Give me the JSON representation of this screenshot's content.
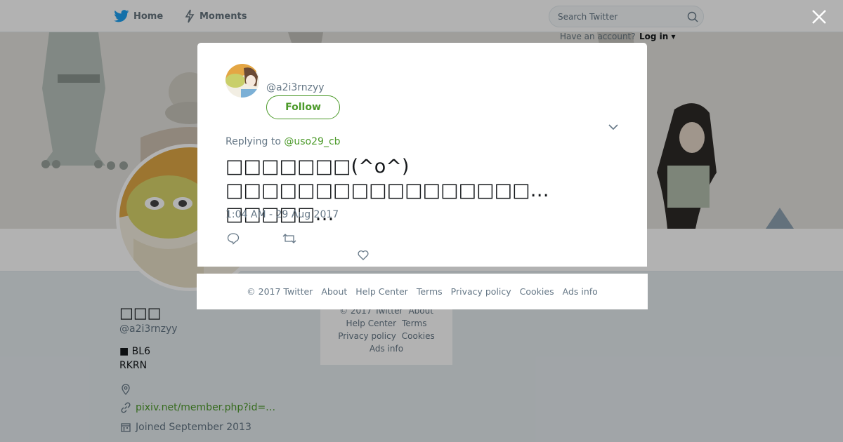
{
  "topbar": {
    "home_label": "Home",
    "moments_label": "Moments",
    "search_placeholder": "Search Twitter",
    "have_account": "Have an account?",
    "login_label": "Log in"
  },
  "profile": {
    "name": "□□□",
    "handle": "@a2i3rnzyy",
    "bio_line1": "■ BL6",
    "bio_line2": "RKRN",
    "link": "pixiv.net/member.php?id=…",
    "joined": "Joined September 2013"
  },
  "bg_footer": [
    "© 2017 Twitter",
    "About",
    "Help Center",
    "Terms",
    "Privacy policy",
    "Cookies",
    "Ads info"
  ],
  "modal": {
    "handle": "@a2i3rnzyy",
    "follow_label": "Follow",
    "replying_prefix": "Replying to",
    "replying_to": "@uso29_cb",
    "tweet_line1": "□□□□□□□(^o^)",
    "tweet_line2": "□□□□□□□□□□□□□□□□□…□□□□□…",
    "timestamp": "1:04 AM - 29 Aug 2017"
  },
  "modal_footer": [
    "© 2017 Twitter",
    "About",
    "Help Center",
    "Terms",
    "Privacy policy",
    "Cookies",
    "Ads info"
  ],
  "colors": {
    "accent": "#4c9a2a",
    "twitter_blue": "#1da1f2",
    "muted": "#657786"
  }
}
